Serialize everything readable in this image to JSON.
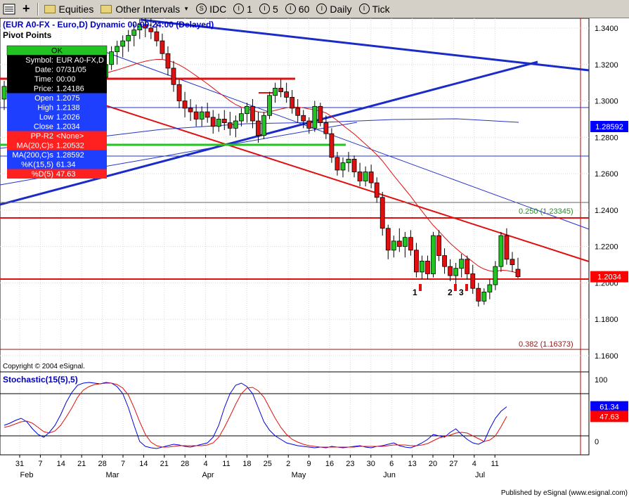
{
  "toolbar": {
    "items": [
      "Equities",
      "Other Intervals",
      "IDC",
      "1",
      "5",
      "60",
      "Daily",
      "Tick"
    ],
    "dropdown_arrow": "▼"
  },
  "chart_header": {
    "title": "(EUR A0-FX - Euro,D) Dynamic 00:00-24:00 (Delayed)",
    "study_label": "Pivot Points"
  },
  "data_window": {
    "ok": "OK",
    "rows": [
      {
        "label": "Symbol:",
        "value": "EUR A0-FX,D",
        "bg": "#000000",
        "fg": "#ffffff"
      },
      {
        "label": "Date:",
        "value": "07/31/05",
        "bg": "#000000",
        "fg": "#ffffff"
      },
      {
        "label": "Time:",
        "value": "00:00",
        "bg": "#000000",
        "fg": "#ffffff"
      },
      {
        "label": "Price:",
        "value": "1.24186",
        "bg": "#000000",
        "fg": "#ffffff"
      },
      {
        "label": "Open",
        "value": "1.2075",
        "bg": "#1f3fff",
        "fg": "#ffffff"
      },
      {
        "label": "High",
        "value": "1.2138",
        "bg": "#1f3fff",
        "fg": "#ffffff"
      },
      {
        "label": "Low",
        "value": "1.2026",
        "bg": "#1f3fff",
        "fg": "#ffffff"
      },
      {
        "label": "Close",
        "value": "1.2034",
        "bg": "#1f3fff",
        "fg": "#ffffff"
      },
      {
        "label": "PP-R2",
        "value": "<None>",
        "bg": "#ff2020",
        "fg": "#ffffff"
      },
      {
        "label": "MA(20,C)s",
        "value": "1.20532",
        "bg": "#ff2020",
        "fg": "#ffffff"
      },
      {
        "label": "MA(200,C)s",
        "value": "1.28592",
        "bg": "#1f3fff",
        "fg": "#ffffff"
      },
      {
        "label": "%K(15,5)",
        "value": "61.34",
        "bg": "#1f3fff",
        "fg": "#ffffff"
      },
      {
        "label": "%D(5)",
        "value": "47.63",
        "bg": "#ff2020",
        "fg": "#ffffff"
      }
    ]
  },
  "copyright": "Copyright © 2004 eSignal.",
  "published": "Published by eSignal (www.esignal.com)",
  "stochastic_label": "Stochastic(15(5),5)",
  "chart_data": {
    "type": "candlestick",
    "y_ticks": [
      "1.3400",
      "1.3200",
      "1.3000",
      "1.2800",
      "1.2600",
      "1.2400",
      "1.2200",
      "1.2000",
      "1.1800",
      "1.1600"
    ],
    "ylim": [
      1.152,
      1.3485
    ],
    "price_tags": [
      {
        "text": "1.28592",
        "value": 1.28592,
        "bg": "#0000ff",
        "fg": "#ffffff"
      },
      {
        "text": "1.2034",
        "value": 1.2034,
        "bg": "#ff0000",
        "fg": "#ffffff"
      }
    ],
    "fib_labels": [
      {
        "text": "0.250 (1.23345)",
        "value": 1.23345,
        "color": "#2e8b2e"
      },
      {
        "text": "0.382 (1.16373)",
        "value": 1.16373,
        "color": "#8b1a1a"
      }
    ],
    "markers": [
      {
        "text": "1",
        "date": "Jun 13"
      },
      {
        "text": "2",
        "date": "Jun 24"
      },
      {
        "text": "3",
        "date": "Jun 29"
      }
    ],
    "x_ticks": [
      "31",
      "7",
      "14",
      "21",
      "28",
      "7",
      "14",
      "21",
      "28",
      "4",
      "11",
      "18",
      "25",
      "2",
      "9",
      "16",
      "23",
      "30",
      "6",
      "13",
      "20",
      "27",
      "4",
      "11"
    ],
    "x_months": [
      "Feb",
      "Mar",
      "Apr",
      "May",
      "Jun",
      "Jul"
    ],
    "stoch_ticks": [
      "100",
      "0"
    ],
    "stoch_tags": [
      {
        "text": "61.34",
        "value": 61.34,
        "bg": "#0000ff",
        "fg": "#ffffff"
      },
      {
        "text": "47.63",
        "value": 47.63,
        "bg": "#ff0000",
        "fg": "#ffffff"
      }
    ],
    "candles": [
      [
        1.301,
        1.311,
        1.295,
        1.308
      ],
      [
        1.308,
        1.316,
        1.303,
        1.312
      ],
      [
        1.312,
        1.322,
        1.309,
        1.318
      ],
      [
        1.318,
        1.323,
        1.307,
        1.31
      ],
      [
        1.31,
        1.317,
        1.306,
        1.314
      ],
      [
        1.314,
        1.319,
        1.301,
        1.304
      ],
      [
        1.304,
        1.315,
        1.302,
        1.313
      ],
      [
        1.313,
        1.32,
        1.31,
        1.316
      ],
      [
        1.316,
        1.318,
        1.302,
        1.305
      ],
      [
        1.305,
        1.312,
        1.3,
        1.309
      ],
      [
        1.309,
        1.312,
        1.298,
        1.301
      ],
      [
        1.301,
        1.307,
        1.296,
        1.304
      ],
      [
        1.304,
        1.312,
        1.303,
        1.31
      ],
      [
        1.31,
        1.318,
        1.306,
        1.315
      ],
      [
        1.315,
        1.321,
        1.31,
        1.312
      ],
      [
        1.312,
        1.317,
        1.306,
        1.309
      ],
      [
        1.309,
        1.318,
        1.306,
        1.316
      ],
      [
        1.316,
        1.32,
        1.31,
        1.313
      ],
      [
        1.313,
        1.323,
        1.31,
        1.32
      ],
      [
        1.32,
        1.33,
        1.317,
        1.327
      ],
      [
        1.327,
        1.333,
        1.32,
        1.33
      ],
      [
        1.33,
        1.336,
        1.324,
        1.333
      ],
      [
        1.333,
        1.339,
        1.327,
        1.336
      ],
      [
        1.336,
        1.342,
        1.33,
        1.339
      ],
      [
        1.339,
        1.345,
        1.334,
        1.342
      ],
      [
        1.342,
        1.347,
        1.335,
        1.34
      ],
      [
        1.34,
        1.346,
        1.334,
        1.338
      ],
      [
        1.338,
        1.343,
        1.33,
        1.333
      ],
      [
        1.333,
        1.337,
        1.323,
        1.326
      ],
      [
        1.326,
        1.33,
        1.314,
        1.318
      ],
      [
        1.318,
        1.322,
        1.305,
        1.309
      ],
      [
        1.309,
        1.312,
        1.296,
        1.3
      ],
      [
        1.3,
        1.305,
        1.291,
        1.296
      ],
      [
        1.296,
        1.301,
        1.289,
        1.294
      ],
      [
        1.294,
        1.298,
        1.286,
        1.29
      ],
      [
        1.29,
        1.297,
        1.286,
        1.294
      ],
      [
        1.294,
        1.299,
        1.288,
        1.291
      ],
      [
        1.291,
        1.295,
        1.282,
        1.286
      ],
      [
        1.286,
        1.293,
        1.283,
        1.29
      ],
      [
        1.29,
        1.295,
        1.284,
        1.288
      ],
      [
        1.288,
        1.294,
        1.281,
        1.285
      ],
      [
        1.285,
        1.292,
        1.28,
        1.289
      ],
      [
        1.289,
        1.296,
        1.286,
        1.293
      ],
      [
        1.293,
        1.299,
        1.288,
        1.297
      ],
      [
        1.297,
        1.301,
        1.285,
        1.289
      ],
      [
        1.289,
        1.294,
        1.277,
        1.281
      ],
      [
        1.281,
        1.294,
        1.279,
        1.292
      ],
      [
        1.292,
        1.305,
        1.29,
        1.303
      ],
      [
        1.303,
        1.31,
        1.299,
        1.307
      ],
      [
        1.307,
        1.312,
        1.302,
        1.305
      ],
      [
        1.305,
        1.31,
        1.299,
        1.302
      ],
      [
        1.302,
        1.306,
        1.293,
        1.296
      ],
      [
        1.296,
        1.301,
        1.288,
        1.292
      ],
      [
        1.292,
        1.295,
        1.285,
        1.289
      ],
      [
        1.289,
        1.291,
        1.282,
        1.285
      ],
      [
        1.285,
        1.3,
        1.283,
        1.297
      ],
      [
        1.297,
        1.299,
        1.286,
        1.288
      ],
      [
        1.288,
        1.292,
        1.279,
        1.282
      ],
      [
        1.282,
        1.285,
        1.266,
        1.269
      ],
      [
        1.269,
        1.272,
        1.259,
        1.262
      ],
      [
        1.262,
        1.269,
        1.258,
        1.266
      ],
      [
        1.266,
        1.272,
        1.261,
        1.268
      ],
      [
        1.268,
        1.27,
        1.258,
        1.261
      ],
      [
        1.261,
        1.266,
        1.253,
        1.256
      ],
      [
        1.256,
        1.264,
        1.253,
        1.261
      ],
      [
        1.261,
        1.265,
        1.252,
        1.255
      ],
      [
        1.255,
        1.258,
        1.244,
        1.247
      ],
      [
        1.247,
        1.25,
        1.226,
        1.23
      ],
      [
        1.23,
        1.232,
        1.213,
        1.218
      ],
      [
        1.218,
        1.226,
        1.214,
        1.223
      ],
      [
        1.223,
        1.23,
        1.217,
        1.22
      ],
      [
        1.22,
        1.228,
        1.214,
        1.225
      ],
      [
        1.225,
        1.229,
        1.215,
        1.218
      ],
      [
        1.218,
        1.222,
        1.203,
        1.206
      ],
      [
        1.206,
        1.215,
        1.202,
        1.212
      ],
      [
        1.212,
        1.215,
        1.202,
        1.205
      ],
      [
        1.205,
        1.228,
        1.203,
        1.226
      ],
      [
        1.226,
        1.229,
        1.212,
        1.215
      ],
      [
        1.215,
        1.219,
        1.205,
        1.209
      ],
      [
        1.209,
        1.213,
        1.201,
        1.204
      ],
      [
        1.204,
        1.211,
        1.199,
        1.208
      ],
      [
        1.208,
        1.216,
        1.203,
        1.213
      ],
      [
        1.213,
        1.215,
        1.202,
        1.205
      ],
      [
        1.205,
        1.21,
        1.194,
        1.197
      ],
      [
        1.197,
        1.2,
        1.187,
        1.19
      ],
      [
        1.19,
        1.197,
        1.188,
        1.195
      ],
      [
        1.195,
        1.202,
        1.191,
        1.199
      ],
      [
        1.199,
        1.212,
        1.196,
        1.209
      ],
      [
        1.209,
        1.228,
        1.206,
        1.226
      ],
      [
        1.226,
        1.23,
        1.21,
        1.213
      ],
      [
        1.213,
        1.217,
        1.206,
        1.21
      ],
      [
        1.2075,
        1.2138,
        1.2026,
        1.2034
      ]
    ],
    "stochastic_k": [
      35,
      38,
      42,
      45,
      40,
      30,
      22,
      18,
      25,
      35,
      50,
      68,
      82,
      92,
      95,
      96,
      95,
      94,
      96,
      95,
      90,
      80,
      60,
      35,
      12,
      5,
      3,
      2,
      4,
      6,
      8,
      7,
      5,
      4,
      6,
      8,
      10,
      18,
      35,
      60,
      80,
      92,
      95,
      90,
      80,
      60,
      40,
      28,
      20,
      15,
      10,
      8,
      6,
      5,
      4,
      3,
      4,
      3,
      5,
      4,
      3,
      4,
      5,
      6,
      4,
      3,
      5,
      6,
      8,
      10,
      6,
      4,
      3,
      6,
      10,
      15,
      22,
      20,
      18,
      25,
      30,
      22,
      15,
      10,
      8,
      12,
      30,
      45,
      55,
      61.34
    ],
    "stochastic_d": [
      32,
      34,
      37,
      40,
      41,
      38,
      32,
      26,
      24,
      27,
      35,
      47,
      60,
      75,
      85,
      90,
      93,
      94,
      95,
      95,
      93,
      88,
      78,
      60,
      40,
      22,
      11,
      6,
      4,
      4,
      5,
      6,
      6,
      6,
      6,
      6,
      7,
      10,
      18,
      32,
      48,
      65,
      80,
      88,
      89,
      84,
      75,
      60,
      45,
      32,
      22,
      15,
      11,
      8,
      6,
      5,
      4,
      4,
      4,
      4,
      4,
      4,
      4,
      5,
      5,
      5,
      5,
      5,
      6,
      7,
      7,
      7,
      6,
      6,
      7,
      9,
      13,
      17,
      19,
      21,
      24,
      25,
      24,
      20,
      16,
      12,
      14,
      20,
      33,
      47.63
    ],
    "ma20": [
      1.305,
      1.3058,
      1.3066,
      1.3072,
      1.3078,
      1.308,
      1.3085,
      1.3092,
      1.3096,
      1.31,
      1.3102,
      1.3104,
      1.311,
      1.3118,
      1.3124,
      1.3128,
      1.3134,
      1.3142,
      1.3152,
      1.3162,
      1.317,
      1.318,
      1.319,
      1.32,
      1.321,
      1.3218,
      1.3224,
      1.3228,
      1.3228,
      1.3222,
      1.3212,
      1.3198,
      1.318,
      1.316,
      1.3138,
      1.3116,
      1.3094,
      1.307,
      1.3046,
      1.3024,
      1.3,
      1.298,
      1.2966,
      1.2956,
      1.2948,
      1.294,
      1.2936,
      1.294,
      1.2948,
      1.2956,
      1.2962,
      1.2966,
      1.2966,
      1.2962,
      1.2956,
      1.2952,
      1.2944,
      1.2934,
      1.2914,
      1.2892,
      1.2866,
      1.2842,
      1.2818,
      1.279,
      1.2762,
      1.2734,
      1.2704,
      1.267,
      1.263,
      1.259,
      1.2552,
      1.2514,
      1.2476,
      1.2434,
      1.2394,
      1.2354,
      1.2316,
      1.2284,
      1.225,
      1.2218,
      1.219,
      1.2164,
      1.214,
      1.2116,
      1.2092,
      1.2076,
      1.2066,
      1.2062,
      1.207,
      1.2068,
      1.2062,
      1.20532
    ]
  }
}
